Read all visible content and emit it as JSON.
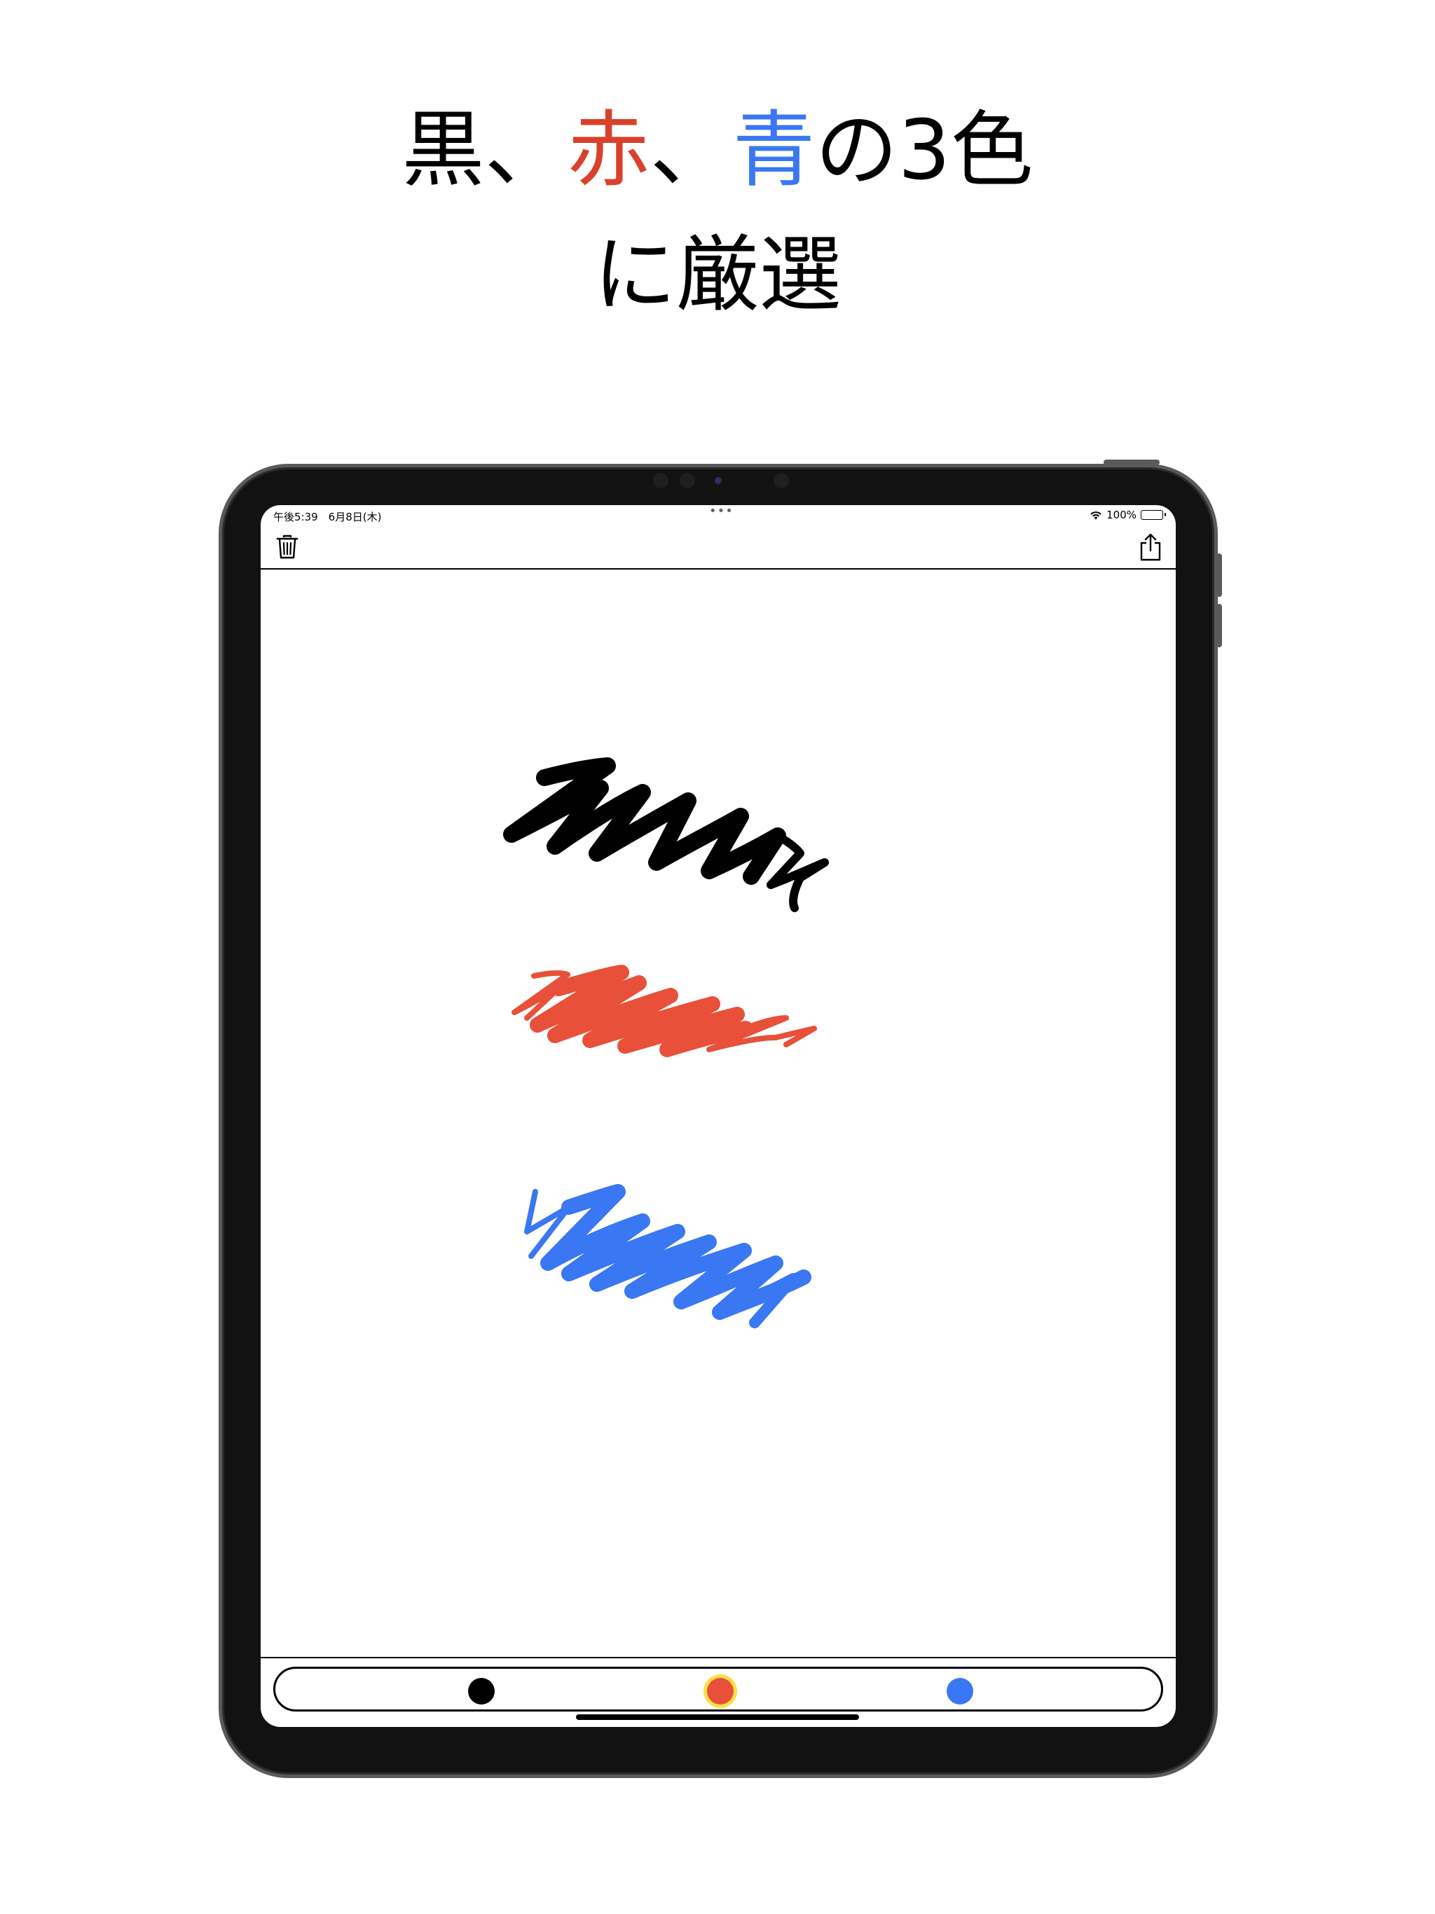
{
  "headline": {
    "line1": [
      {
        "text": "黒",
        "color": "#000000"
      },
      {
        "text": "、",
        "color": "#000000"
      },
      {
        "text": "赤",
        "color": "#d9412a"
      },
      {
        "text": "、",
        "color": "#000000"
      },
      {
        "text": "青",
        "color": "#3a77f2"
      },
      {
        "text": "の3色",
        "color": "#000000"
      }
    ],
    "line2": "に厳選"
  },
  "status_bar": {
    "time": "午後5:39　6月8日(木)",
    "battery": "100%"
  },
  "toolbar": {
    "trash_icon": "trash-icon",
    "share_icon": "share-icon"
  },
  "palette": {
    "colors": [
      "#000000",
      "#e8503a",
      "#3a77f2"
    ],
    "selected_index": 1
  },
  "colors": {
    "black_ink": "#000000",
    "red_ink": "#e8503a",
    "blue_ink": "#3a77f2",
    "selection_ring": "#f7e04a"
  }
}
